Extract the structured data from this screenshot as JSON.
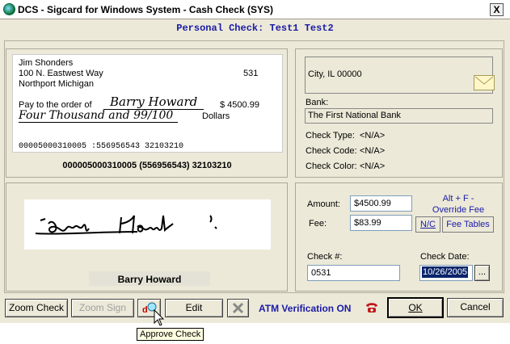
{
  "window": {
    "title": "DCS - Sigcard for Windows System - Cash Check (SYS)",
    "close_glyph": "X"
  },
  "subtitle": "Personal Check: Test1 Test2",
  "check": {
    "payer_name": "Jim Shonders",
    "address1": "100 N. Eastwest Way",
    "address2": "Northport Michigan",
    "check_number": "531",
    "pay_to_label": "Pay to the order of",
    "payee_handwritten": "Barry Howard",
    "amount": "$  4500.99",
    "amount_words_handwritten": "Four Thousand and 99/100",
    "dollars_label": "Dollars",
    "micr_line": "00005000310005   :556956543  32103210",
    "micr_caption": "000005000310005 (556956543) 32103210"
  },
  "signature": {
    "handwritten": "Barry Howard",
    "name": "Barry Howard"
  },
  "bank_info": {
    "city_state": "City, IL 00000",
    "bank_label": "Bank:",
    "bank_name": "The First National Bank",
    "check_type_label": "Check Type:",
    "check_type_value": "<N/A>",
    "check_code_label": "Check Code:",
    "check_code_value": "<N/A>",
    "check_color_label": "Check Color:",
    "check_color_value": "<N/A>"
  },
  "transaction": {
    "amount_label": "Amount:",
    "amount_value": "$4500.99",
    "fee_label": "Fee:",
    "fee_value": "$83.99",
    "override_hint": "Alt + F -\nOverride Fee",
    "nc_button": "N/C",
    "fee_tables_button": "Fee Tables",
    "check_no_label": "Check #:",
    "check_no_value": "0531",
    "check_date_label": "Check Date:",
    "check_date_value": "10/26/2005",
    "date_picker_button": "..."
  },
  "toolbar": {
    "zoom_check": "Zoom Check",
    "zoom_sign": "Zoom Sign",
    "edit": "Edit",
    "atm_status": "ATM Verification ON",
    "ok": "OK",
    "cancel": "Cancel"
  },
  "tooltip": "Approve Check",
  "colors": {
    "accent_blue": "#1a1aa8",
    "window_bg": "#ece9d8",
    "selected_field": "#0a246a"
  }
}
